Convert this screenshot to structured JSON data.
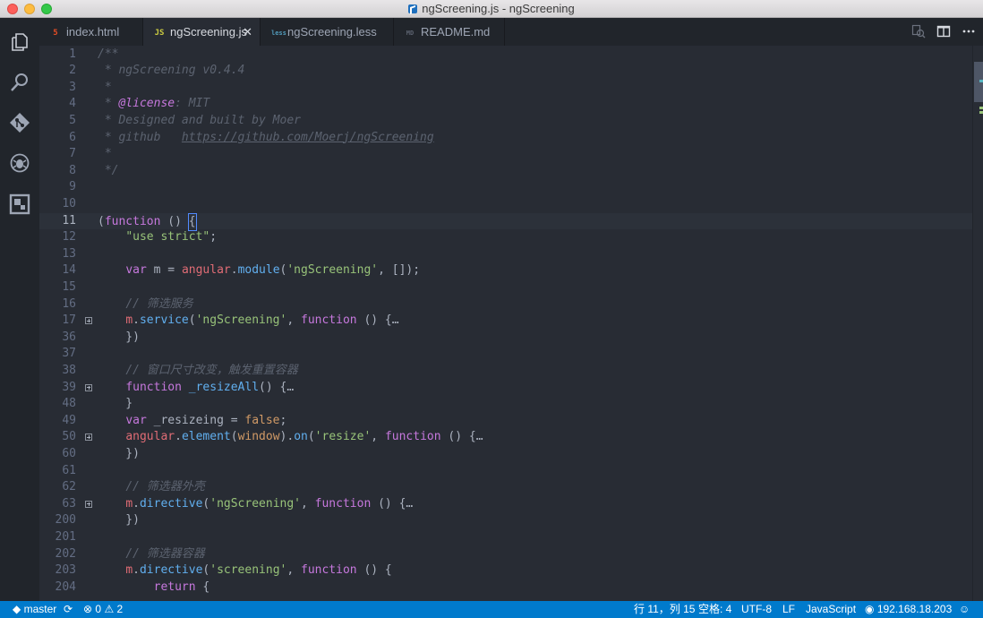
{
  "window": {
    "title": "ngScreening.js - ngScreening"
  },
  "activity_bar": [
    "explorer",
    "search",
    "git",
    "debug",
    "extensions"
  ],
  "tabs": [
    {
      "label": "index.html",
      "icon_glyph": "5",
      "icon_color": "#e44d26",
      "active": false
    },
    {
      "label": "ngScreening.js",
      "icon_glyph": "JS",
      "icon_color": "#cbcb41",
      "active": true,
      "close": "✕"
    },
    {
      "label": "ngScreening.less",
      "icon_glyph": "less",
      "icon_color": "#519aba",
      "active": false
    },
    {
      "label": "README.md",
      "icon_glyph": "MD",
      "icon_color": "#5c6370",
      "active": false
    }
  ],
  "tab_actions": [
    "search-changes",
    "split-editor",
    "more"
  ],
  "editor": {
    "lines": [
      {
        "n": "1",
        "fold": false,
        "tokens": [
          [
            "cm",
            "/**"
          ]
        ]
      },
      {
        "n": "2",
        "fold": false,
        "tokens": [
          [
            "cm",
            " * ngScreening v0.4.4"
          ]
        ]
      },
      {
        "n": "3",
        "fold": false,
        "tokens": [
          [
            "cm",
            " *"
          ]
        ]
      },
      {
        "n": "4",
        "fold": false,
        "tokens": [
          [
            "cm",
            " * "
          ],
          [
            "tag",
            "@license"
          ],
          [
            "cm",
            ": MIT"
          ]
        ]
      },
      {
        "n": "5",
        "fold": false,
        "tokens": [
          [
            "cm",
            " * Designed and built by Moer"
          ]
        ]
      },
      {
        "n": "6",
        "fold": false,
        "tokens": [
          [
            "cm",
            " * github   "
          ],
          [
            "link",
            "https://github.com/Moerj/ngScreening"
          ]
        ]
      },
      {
        "n": "7",
        "fold": false,
        "tokens": [
          [
            "cm",
            " *"
          ]
        ]
      },
      {
        "n": "8",
        "fold": false,
        "tokens": [
          [
            "cm",
            " */"
          ]
        ]
      },
      {
        "n": "9",
        "fold": false,
        "tokens": []
      },
      {
        "n": "10",
        "fold": false,
        "tokens": []
      },
      {
        "n": "11",
        "fold": false,
        "current": true,
        "tokens": [
          [
            "plain",
            "("
          ],
          [
            "kw",
            "function"
          ],
          [
            "plain",
            " () "
          ],
          [
            "cursor",
            "{"
          ]
        ]
      },
      {
        "n": "12",
        "fold": false,
        "tokens": [
          [
            "plain",
            "    "
          ],
          [
            "str",
            "\"use strict\""
          ],
          [
            "plain",
            ";"
          ]
        ]
      },
      {
        "n": "13",
        "fold": false,
        "tokens": []
      },
      {
        "n": "14",
        "fold": false,
        "tokens": [
          [
            "plain",
            "    "
          ],
          [
            "kw",
            "var"
          ],
          [
            "plain",
            " m = "
          ],
          [
            "var",
            "angular"
          ],
          [
            "plain",
            "."
          ],
          [
            "fn",
            "module"
          ],
          [
            "plain",
            "("
          ],
          [
            "str",
            "'ngScreening'"
          ],
          [
            "plain",
            ", []);"
          ]
        ]
      },
      {
        "n": "15",
        "fold": false,
        "tokens": []
      },
      {
        "n": "16",
        "fold": false,
        "tokens": [
          [
            "plain",
            "    "
          ],
          [
            "cm",
            "// 筛选服务"
          ]
        ]
      },
      {
        "n": "17",
        "fold": true,
        "tokens": [
          [
            "plain",
            "    "
          ],
          [
            "var",
            "m"
          ],
          [
            "plain",
            "."
          ],
          [
            "fn",
            "service"
          ],
          [
            "plain",
            "("
          ],
          [
            "str",
            "'ngScreening'"
          ],
          [
            "plain",
            ", "
          ],
          [
            "kw",
            "function"
          ],
          [
            "plain",
            " () {"
          ],
          [
            "dots",
            "…"
          ]
        ]
      },
      {
        "n": "36",
        "fold": false,
        "tokens": [
          [
            "plain",
            "    })"
          ]
        ]
      },
      {
        "n": "37",
        "fold": false,
        "tokens": []
      },
      {
        "n": "38",
        "fold": false,
        "tokens": [
          [
            "plain",
            "    "
          ],
          [
            "cm",
            "// 窗口尺寸改变，触发重置容器"
          ]
        ]
      },
      {
        "n": "39",
        "fold": true,
        "tokens": [
          [
            "plain",
            "    "
          ],
          [
            "kw",
            "function"
          ],
          [
            "plain",
            " "
          ],
          [
            "fn",
            "_resizeAll"
          ],
          [
            "plain",
            "() {"
          ],
          [
            "dots",
            "…"
          ]
        ]
      },
      {
        "n": "48",
        "fold": false,
        "tokens": [
          [
            "plain",
            "    }"
          ]
        ]
      },
      {
        "n": "49",
        "fold": false,
        "tokens": [
          [
            "plain",
            "    "
          ],
          [
            "kw",
            "var"
          ],
          [
            "plain",
            " _resizeing = "
          ],
          [
            "bool",
            "false"
          ],
          [
            "plain",
            ";"
          ]
        ]
      },
      {
        "n": "50",
        "fold": true,
        "tokens": [
          [
            "plain",
            "    "
          ],
          [
            "var",
            "angular"
          ],
          [
            "plain",
            "."
          ],
          [
            "fn",
            "element"
          ],
          [
            "plain",
            "("
          ],
          [
            "bool",
            "window"
          ],
          [
            "plain",
            ")."
          ],
          [
            "fn",
            "on"
          ],
          [
            "plain",
            "("
          ],
          [
            "str",
            "'resize'"
          ],
          [
            "plain",
            ", "
          ],
          [
            "kw",
            "function"
          ],
          [
            "plain",
            " () {"
          ],
          [
            "dots",
            "…"
          ]
        ]
      },
      {
        "n": "60",
        "fold": false,
        "tokens": [
          [
            "plain",
            "    })"
          ]
        ]
      },
      {
        "n": "61",
        "fold": false,
        "tokens": []
      },
      {
        "n": "62",
        "fold": false,
        "tokens": [
          [
            "plain",
            "    "
          ],
          [
            "cm",
            "// 筛选器外壳"
          ]
        ]
      },
      {
        "n": "63",
        "fold": true,
        "tokens": [
          [
            "plain",
            "    "
          ],
          [
            "var",
            "m"
          ],
          [
            "plain",
            "."
          ],
          [
            "fn",
            "directive"
          ],
          [
            "plain",
            "("
          ],
          [
            "str",
            "'ngScreening'"
          ],
          [
            "plain",
            ", "
          ],
          [
            "kw",
            "function"
          ],
          [
            "plain",
            " () {"
          ],
          [
            "dots",
            "…"
          ]
        ]
      },
      {
        "n": "200",
        "fold": false,
        "tokens": [
          [
            "plain",
            "    })"
          ]
        ]
      },
      {
        "n": "201",
        "fold": false,
        "tokens": []
      },
      {
        "n": "202",
        "fold": false,
        "tokens": [
          [
            "plain",
            "    "
          ],
          [
            "cm",
            "// 筛选器容器"
          ]
        ]
      },
      {
        "n": "203",
        "fold": false,
        "tokens": [
          [
            "plain",
            "    "
          ],
          [
            "var",
            "m"
          ],
          [
            "plain",
            "."
          ],
          [
            "fn",
            "directive"
          ],
          [
            "plain",
            "("
          ],
          [
            "str",
            "'screening'"
          ],
          [
            "plain",
            ", "
          ],
          [
            "kw",
            "function"
          ],
          [
            "plain",
            " () {"
          ]
        ]
      },
      {
        "n": "204",
        "fold": false,
        "tokens": [
          [
            "plain",
            "        "
          ],
          [
            "kw",
            "return"
          ],
          [
            "plain",
            " {"
          ]
        ]
      }
    ]
  },
  "status": {
    "branch": "master",
    "errors": "0",
    "warnings": "2",
    "position": "行 11，列 15",
    "indent": "空格: 4",
    "encoding": "UTF-8",
    "eol": "LF",
    "language": "JavaScript",
    "remote": "192.168.18.203"
  }
}
